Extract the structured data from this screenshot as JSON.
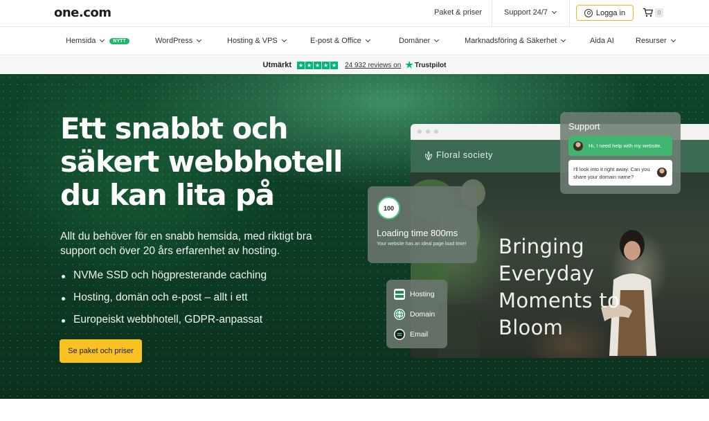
{
  "header": {
    "logo": "one.com",
    "links": {
      "packages": "Paket & priser",
      "support": "Support 24/7"
    },
    "login_label": "Logga in",
    "cart_count": "0"
  },
  "nav": {
    "items": [
      {
        "label": "Hemsida",
        "badge": "NYTT"
      },
      {
        "label": "WordPress"
      },
      {
        "label": "Hosting & VPS"
      },
      {
        "label": "E-post & Office"
      },
      {
        "label": "Domäner"
      },
      {
        "label": "Marknadsföring & Säkerhet"
      },
      {
        "label": "Aida AI"
      },
      {
        "label": "Resurser"
      }
    ]
  },
  "trust": {
    "rating": "Utmärkt",
    "reviews": "24 932 reviews on",
    "brand": "Trustpilot",
    "stars": 5,
    "color": "#00b67a"
  },
  "hero": {
    "title": "Ett snabbt och säkert webbhotell du kan lita på",
    "subtitle": "Allt du behöver för en snabb hemsida, med riktigt bra support och över 20 års erfarenhet av hosting.",
    "bullets": [
      "NVMe SSD och högpresterande caching",
      "Hosting, domän och e-post – allt i ett",
      "Europeiskt webbhotell, GDPR-anpassat"
    ],
    "cta": "Se paket och priser"
  },
  "mockup": {
    "site_name": "Floral society",
    "hero_text": [
      "Bringing",
      "Everyday",
      "Moments to",
      "Bloom"
    ],
    "support": {
      "title": "Support",
      "user_msg": "Hi, I need help with my website.",
      "agent_msg": "I'll look into it right away. Can you share your domain name?"
    },
    "loading": {
      "score": "100",
      "title": "Loading time 800ms",
      "desc": "Your website has an ideal page load time!"
    },
    "services": [
      "Hosting",
      "Domain",
      "Email"
    ]
  },
  "colors": {
    "accent": "#f8c223",
    "hero_bg": "#0c3a22",
    "badge": "#1fb86a"
  }
}
